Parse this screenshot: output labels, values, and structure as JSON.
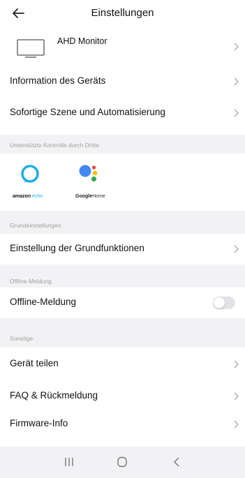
{
  "header": {
    "title": "Einstellungen"
  },
  "device": {
    "name": "AHD Monitor"
  },
  "menu": {
    "info": "Information des Geräts",
    "scene": "Sofortige Szene und Automatisierung"
  },
  "third_party": {
    "section_label": "Unterstützte Kontrolle durch Dritte",
    "amazon_brand": "amazon",
    "amazon_product": "echo",
    "google_brand": "Google",
    "google_product": "Home"
  },
  "basic": {
    "section_label": "Grundeinstellungen",
    "item": "Einstellung der Grundfunktionen"
  },
  "offline": {
    "section_label": "Offline-Meldung",
    "item": "Offline-Meldung",
    "enabled": false
  },
  "other": {
    "section_label": "Sonstige",
    "share": "Gerät teilen",
    "faq": "FAQ & Rückmeldung",
    "firmware": "Firmware-Info"
  },
  "colors": {
    "alexa_blue": "#1faee8",
    "google_blue": "#4285f4",
    "google_red": "#ea4335",
    "google_yellow": "#fbbc05",
    "google_green": "#34a853"
  },
  "icons": [
    "back-arrow-icon",
    "monitor-icon",
    "chevron-right-icon",
    "amazon-echo-logo",
    "google-home-logo",
    "recent-apps-icon",
    "home-icon",
    "back-icon"
  ]
}
